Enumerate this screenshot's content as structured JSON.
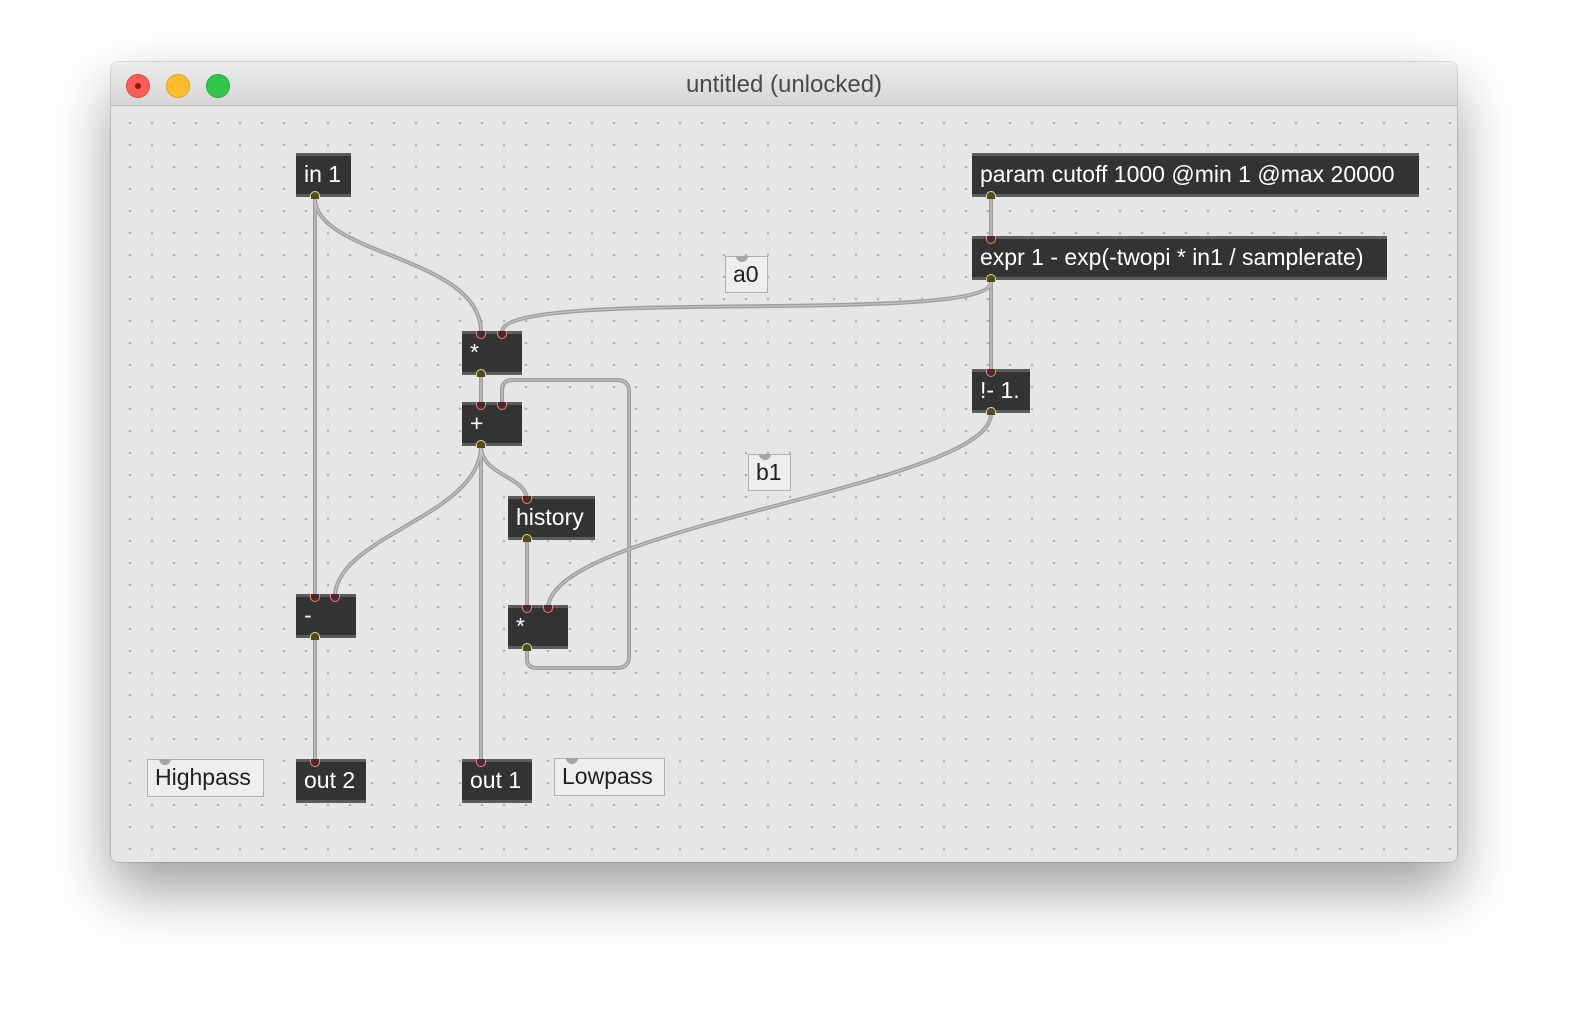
{
  "window": {
    "title": "untitled (unlocked)"
  },
  "objects": {
    "in1": "in 1",
    "param": "param cutoff 1000 @min 1 @max 20000",
    "expr": "expr 1 - exp(-twopi * in1 / samplerate)",
    "mul1": "*",
    "add": "+",
    "history": "history",
    "mul2": "*",
    "invert": "!- 1.",
    "sub": "-",
    "out2": "out 2",
    "out1": "out 1"
  },
  "comments": {
    "a0": "a0",
    "b1": "b1",
    "highpass": "Highpass",
    "lowpass": "Lowpass"
  },
  "colors": {
    "object_bg": "#333333",
    "object_border": "#5c5c5c",
    "patch_cord": "#a0a0a0",
    "canvas": "#e6e6e6",
    "inlet": "#e9887c",
    "outlet": "#e4e28a"
  }
}
